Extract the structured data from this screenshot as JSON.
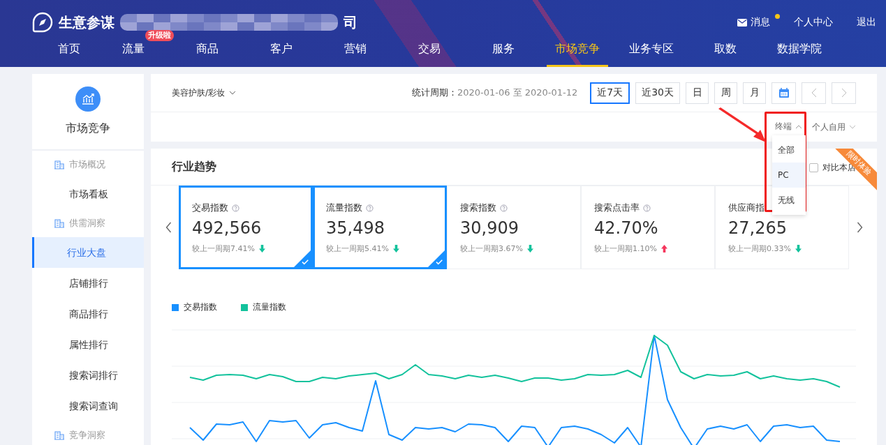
{
  "header": {
    "brand": "生意参谋",
    "company_suffix": "司",
    "user_links": [
      {
        "label": "消息",
        "kind": "message",
        "unread": true
      },
      {
        "label": "个人中心",
        "kind": "plain"
      },
      {
        "label": "退出",
        "kind": "plain"
      }
    ],
    "nav": [
      {
        "label": "首页",
        "selected": false
      },
      {
        "label": "流量",
        "selected": false,
        "badge": "升级啦"
      },
      {
        "label": "商品",
        "selected": false
      },
      {
        "label": "客户",
        "selected": false
      },
      {
        "label": "营销",
        "selected": false
      },
      {
        "label": "交易",
        "selected": false
      },
      {
        "label": "服务",
        "selected": false
      },
      {
        "label": "市场竞争",
        "selected": true
      },
      {
        "label": "业务专区",
        "selected": false
      },
      {
        "label": "取数",
        "selected": false
      },
      {
        "label": "数据学院",
        "selected": false
      }
    ]
  },
  "sidebar": {
    "title": "市场竞争",
    "groups": [
      {
        "label": "市场概况",
        "items": [
          {
            "label": "市场看板",
            "selected": false
          }
        ]
      },
      {
        "label": "供需洞察",
        "items": [
          {
            "label": "行业大盘",
            "selected": true
          },
          {
            "label": "店铺排行",
            "selected": false
          },
          {
            "label": "商品排行",
            "selected": false
          },
          {
            "label": "属性排行",
            "selected": false
          },
          {
            "label": "搜索词排行",
            "selected": false
          },
          {
            "label": "搜索词查询",
            "selected": false
          }
        ]
      },
      {
        "label": "竞争洞察"
      }
    ]
  },
  "filters": {
    "category": "美容护肤/彩妆",
    "period_label": "统计周期：",
    "period_value": "2020-01-06 至 2020-01-12",
    "ranges": [
      {
        "label": "近7天",
        "selected": true
      },
      {
        "label": "近30天",
        "selected": false
      },
      {
        "label": "日",
        "selected": false
      },
      {
        "label": "周",
        "selected": false
      },
      {
        "label": "月",
        "selected": false
      }
    ],
    "terminal": {
      "label": "终端",
      "expanded": true,
      "options": [
        {
          "label": "全部",
          "selected": false
        },
        {
          "label": "PC",
          "selected": true
        },
        {
          "label": "无线",
          "selected": false
        }
      ]
    },
    "usage": {
      "label": "个人自用"
    }
  },
  "trend": {
    "title": "行业趋势",
    "compare": {
      "label": "对比本店",
      "checked": false
    },
    "ribbon": "限时体验",
    "metrics": [
      {
        "name": "交易指数",
        "value": "492,566",
        "change": "较上一周期7.41%",
        "kind": "down",
        "help": true,
        "selected": true
      },
      {
        "name": "流量指数",
        "value": "35,498",
        "change": "较上一周期5.41%",
        "kind": "down",
        "help": true,
        "selected": true
      },
      {
        "name": "搜索指数",
        "value": "30,909",
        "change": "较上一周期3.67%",
        "kind": "down",
        "help": true,
        "selected": false
      },
      {
        "name": "搜索点击率",
        "value": "42.70%",
        "change": "较上一周期1.10%",
        "kind": "up",
        "help": true,
        "selected": false
      },
      {
        "name": "供应商指",
        "value": "27,265",
        "change": "较上一周期0.33%",
        "kind": "down",
        "help": false,
        "selected": false
      }
    ],
    "legend": [
      {
        "label": "交易指数",
        "color": "#1890ff"
      },
      {
        "label": "流量指数",
        "color": "#13c29c"
      }
    ]
  }
}
